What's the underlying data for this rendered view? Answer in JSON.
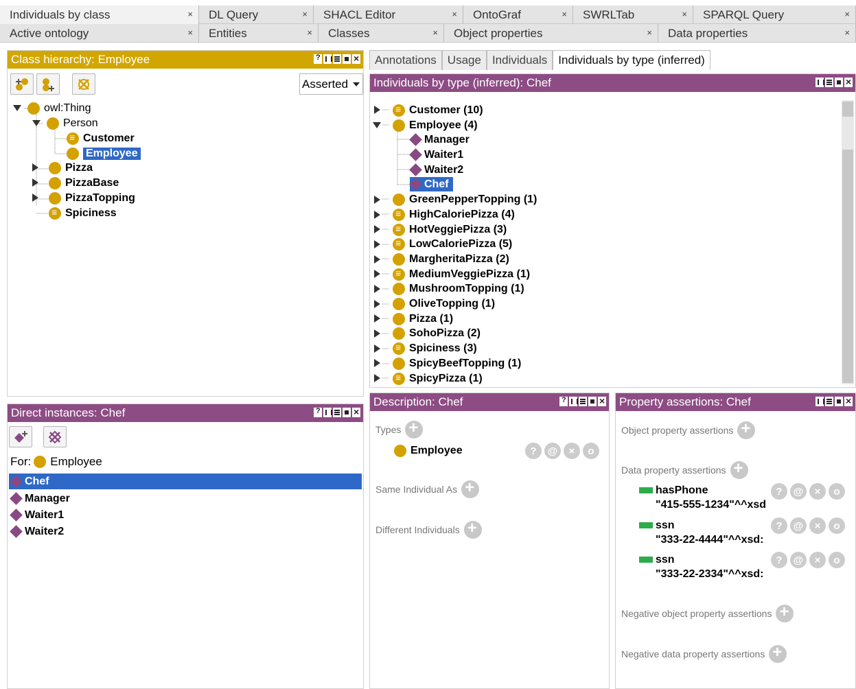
{
  "tabs_top": [
    {
      "label": "Individuals by class"
    },
    {
      "label": "DL Query"
    },
    {
      "label": "SHACL Editor"
    },
    {
      "label": "OntoGraf"
    },
    {
      "label": "SWRLTab"
    },
    {
      "label": "SPARQL Query"
    }
  ],
  "tabs_second": [
    {
      "label": "Active ontology"
    },
    {
      "label": "Entities"
    },
    {
      "label": "Classes"
    },
    {
      "label": "Object properties"
    },
    {
      "label": "Data properties"
    }
  ],
  "class_hierarchy": {
    "title": "Class hierarchy: Employee",
    "mode": "Asserted",
    "tree": [
      {
        "label": "owl:Thing"
      },
      {
        "label": "Person"
      },
      {
        "label": "Customer"
      },
      {
        "label": "Employee"
      },
      {
        "label": "Pizza"
      },
      {
        "label": "PizzaBase"
      },
      {
        "label": "PizzaTopping"
      },
      {
        "label": "Spiciness"
      }
    ]
  },
  "direct_instances": {
    "title": "Direct instances: Chef",
    "for_label": "For:",
    "for_class": "Employee",
    "items": [
      {
        "label": "Chef"
      },
      {
        "label": "Manager"
      },
      {
        "label": "Waiter1"
      },
      {
        "label": "Waiter2"
      }
    ]
  },
  "subtabs": [
    {
      "label": "Annotations"
    },
    {
      "label": "Usage"
    },
    {
      "label": "Individuals"
    },
    {
      "label": "Individuals by type (inferred)"
    }
  ],
  "inferred": {
    "title": "Individuals by type (inferred): Chef",
    "items": [
      {
        "label": "Customer (10)"
      },
      {
        "label": "Employee (4)"
      },
      {
        "label": "Manager"
      },
      {
        "label": "Waiter1"
      },
      {
        "label": "Waiter2"
      },
      {
        "label": "Chef"
      },
      {
        "label": "GreenPepperTopping (1)"
      },
      {
        "label": "HighCaloriePizza (4)"
      },
      {
        "label": "HotVeggiePizza (3)"
      },
      {
        "label": "LowCaloriePizza (5)"
      },
      {
        "label": "MargheritaPizza (2)"
      },
      {
        "label": "MediumVeggiePizza (1)"
      },
      {
        "label": "MushroomTopping (1)"
      },
      {
        "label": "OliveTopping (1)"
      },
      {
        "label": "Pizza (1)"
      },
      {
        "label": "SohoPizza (2)"
      },
      {
        "label": "Spiciness (3)"
      },
      {
        "label": "SpicyBeefTopping (1)"
      },
      {
        "label": "SpicyPizza (1)"
      }
    ]
  },
  "description": {
    "title": "Description: Chef",
    "types_label": "Types",
    "type_value": "Employee",
    "same_label": "Same Individual As",
    "different_label": "Different Individuals"
  },
  "property_assertions": {
    "title": "Property assertions: Chef",
    "object_label": "Object property assertions",
    "data_label": "Data property assertions",
    "data_items": [
      {
        "prop": "hasPhone",
        "value": "\"415-555-1234\"^^xsd"
      },
      {
        "prop": "ssn",
        "value": "\"333-22-4444\"^^xsd:"
      },
      {
        "prop": "ssn",
        "value": "\"333-22-2334\"^^xsd:"
      }
    ],
    "neg_object_label": "Negative object property assertions",
    "neg_data_label": "Negative data property assertions"
  },
  "row_buttons": {
    "help": "?",
    "annotate": "@",
    "delete": "×",
    "edit": "o"
  }
}
